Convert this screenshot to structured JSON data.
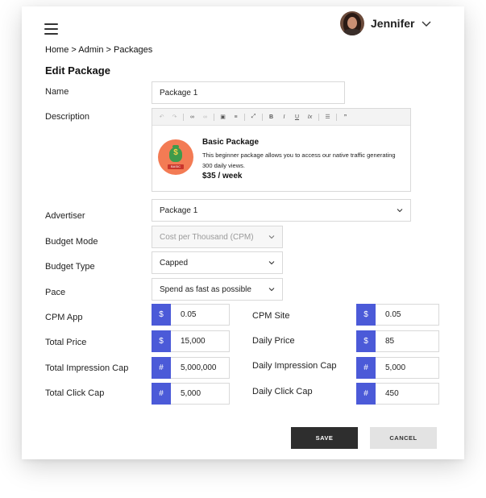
{
  "header": {
    "user_name": "Jennifer"
  },
  "breadcrumb": "Home > Admin > Packages",
  "page_title": "Edit Package",
  "labels": {
    "name": "Name",
    "description": "Description",
    "advertiser": "Advertiser",
    "budget_mode": "Budget Mode",
    "budget_type": "Budget Type",
    "pace": "Pace",
    "cpm_app": "CPM App",
    "total_price": "Total Price",
    "total_impression_cap": "Total Impression Cap",
    "total_click_cap": "Total Click Cap",
    "cpm_site": "CPM Site",
    "daily_price": "Daily Price",
    "daily_impression_cap": "Daily Impression Cap",
    "daily_click_cap": "Daily Click Cap"
  },
  "fields": {
    "name": "Package 1",
    "advertiser": "Package 1",
    "budget_mode": "Cost per Thousand (CPM)",
    "budget_type": "Capped",
    "pace": "Spend as fast as possible"
  },
  "description": {
    "title": "Basic Package",
    "text": "This beginner package allows you to access our native traffic generating 300 daily views.",
    "price": "$35 / week",
    "icon_tag": "BASIC"
  },
  "metrics": {
    "cpm_app": {
      "prefix": "$",
      "value": "0.05"
    },
    "total_price": {
      "prefix": "$",
      "value": "15,000"
    },
    "total_impression_cap": {
      "prefix": "#",
      "value": "5,000,000"
    },
    "total_click_cap": {
      "prefix": "#",
      "value": "5,000"
    },
    "cpm_site": {
      "prefix": "$",
      "value": "0.05"
    },
    "daily_price": {
      "prefix": "$",
      "value": "85"
    },
    "daily_impression_cap": {
      "prefix": "#",
      "value": "5,000"
    },
    "daily_click_cap": {
      "prefix": "#",
      "value": "450"
    }
  },
  "buttons": {
    "save": "SAVE",
    "cancel": "CANCEL"
  },
  "colors": {
    "accent": "#4b5ad8",
    "save_bg": "#2e2e2e",
    "cancel_bg": "#e3e3e3"
  }
}
